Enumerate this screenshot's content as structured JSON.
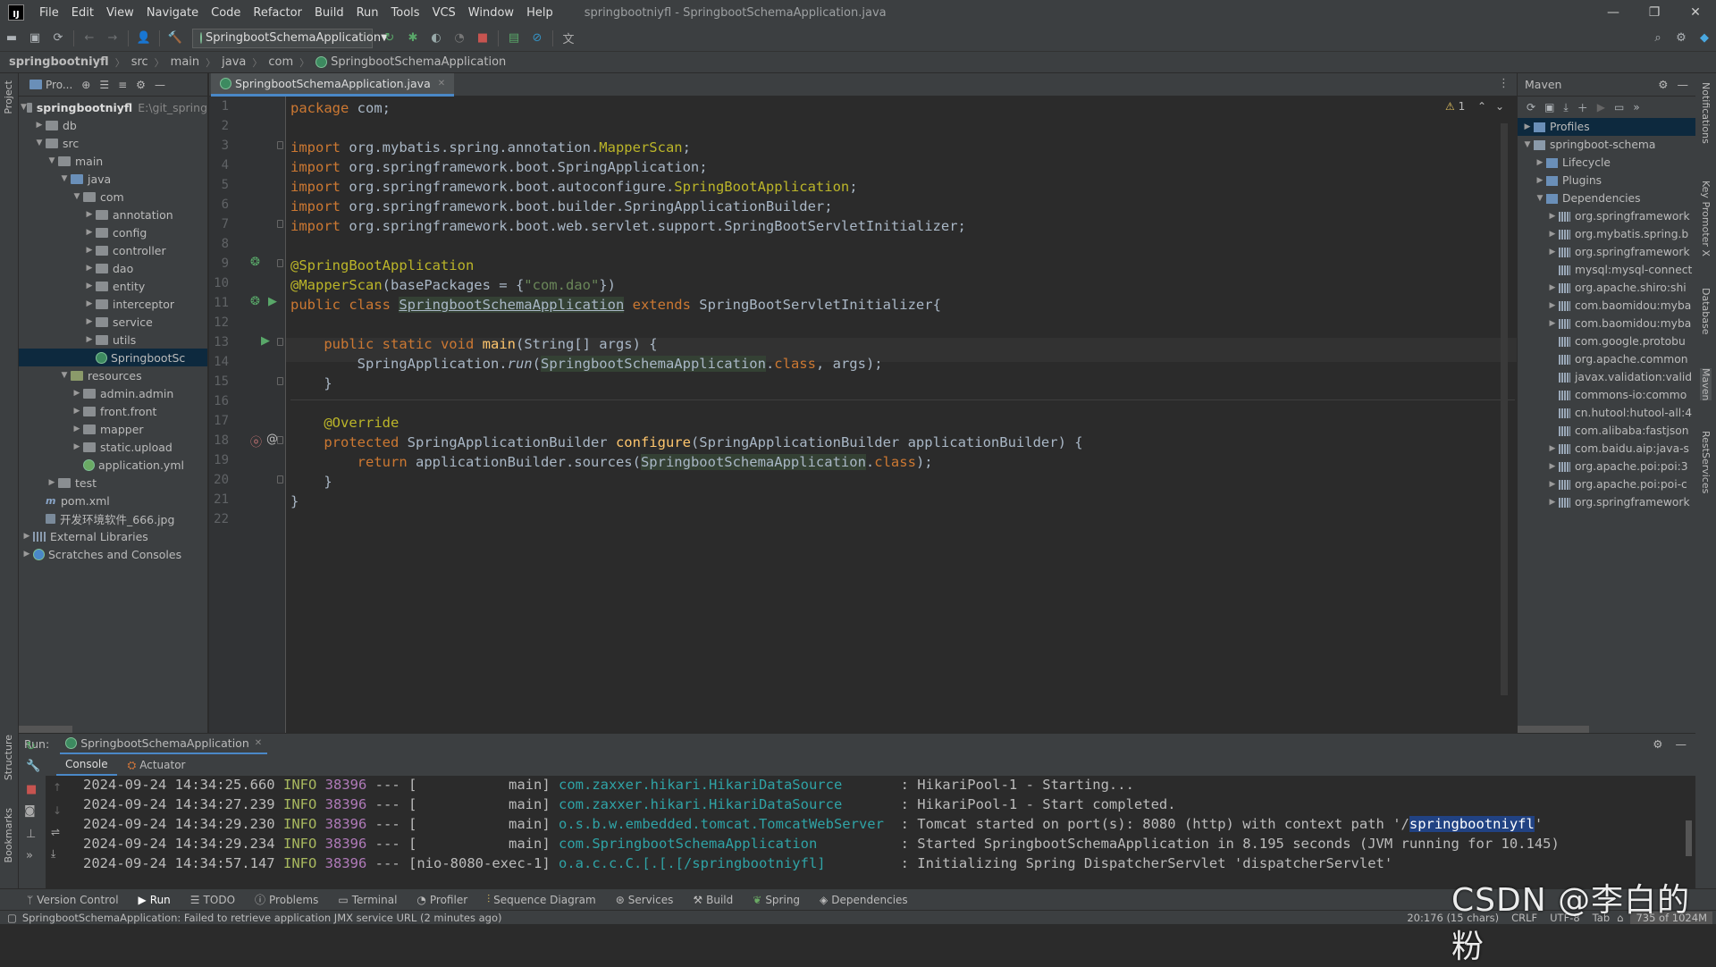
{
  "menubar": {
    "logo": "IJ",
    "items": [
      "File",
      "Edit",
      "View",
      "Navigate",
      "Code",
      "Refactor",
      "Build",
      "Run",
      "Tools",
      "VCS",
      "Window",
      "Help"
    ],
    "window_title": "springbootniyfl - SpringbootSchemaApplication.java"
  },
  "toolbar": {
    "run_config": "SpringbootSchemaApplication"
  },
  "navbar": {
    "crumbs": [
      "springbootniyfl",
      "src",
      "main",
      "java",
      "com",
      "SpringbootSchemaApplication"
    ]
  },
  "left_stripe": {
    "project": "Project",
    "structure": "Structure",
    "bookmarks": "Bookmarks"
  },
  "project_panel": {
    "title": "Pro...",
    "root_name": "springbootniyfl",
    "root_path": "E:\\git_spring",
    "tree": [
      {
        "label": "db",
        "depth": 1,
        "type": "folder"
      },
      {
        "label": "src",
        "depth": 1,
        "type": "folder",
        "open": true
      },
      {
        "label": "main",
        "depth": 2,
        "type": "folder",
        "open": true
      },
      {
        "label": "java",
        "depth": 3,
        "type": "folder-blue",
        "open": true
      },
      {
        "label": "com",
        "depth": 4,
        "type": "folder",
        "open": true
      },
      {
        "label": "annotation",
        "depth": 5,
        "type": "folder"
      },
      {
        "label": "config",
        "depth": 5,
        "type": "folder"
      },
      {
        "label": "controller",
        "depth": 5,
        "type": "folder"
      },
      {
        "label": "dao",
        "depth": 5,
        "type": "folder"
      },
      {
        "label": "entity",
        "depth": 5,
        "type": "folder"
      },
      {
        "label": "interceptor",
        "depth": 5,
        "type": "folder"
      },
      {
        "label": "service",
        "depth": 5,
        "type": "folder"
      },
      {
        "label": "utils",
        "depth": 5,
        "type": "folder"
      },
      {
        "label": "SpringbootSc",
        "depth": 5,
        "type": "class",
        "selected": true
      },
      {
        "label": "resources",
        "depth": 3,
        "type": "folder-res",
        "open": true
      },
      {
        "label": "admin.admin",
        "depth": 4,
        "type": "folder"
      },
      {
        "label": "front.front",
        "depth": 4,
        "type": "folder"
      },
      {
        "label": "mapper",
        "depth": 4,
        "type": "folder"
      },
      {
        "label": "static.upload",
        "depth": 4,
        "type": "folder"
      },
      {
        "label": "application.yml",
        "depth": 4,
        "type": "yml"
      },
      {
        "label": "test",
        "depth": 2,
        "type": "folder"
      },
      {
        "label": "pom.xml",
        "depth": 1,
        "type": "xml"
      },
      {
        "label": "开发环境软件_666.jpg",
        "depth": 1,
        "type": "file"
      },
      {
        "label": "External Libraries",
        "depth": 0,
        "type": "lib"
      },
      {
        "label": "Scratches and Consoles",
        "depth": 0,
        "type": "scratch"
      }
    ]
  },
  "editor": {
    "tab": "SpringbootSchemaApplication.java",
    "warnings": "1",
    "line_numbers": [
      "1",
      "2",
      "3",
      "4",
      "5",
      "6",
      "7",
      "8",
      "9",
      "10",
      "11",
      "12",
      "13",
      "14",
      "15",
      "16",
      "17",
      "18",
      "19",
      "20",
      "21",
      "22"
    ]
  },
  "maven": {
    "title": "Maven",
    "items": [
      {
        "label": "Profiles",
        "depth": 0,
        "icon": "folder",
        "selected": true
      },
      {
        "label": "springboot-schema",
        "depth": 0,
        "icon": "maven",
        "open": true
      },
      {
        "label": "Lifecycle",
        "depth": 1,
        "icon": "folder"
      },
      {
        "label": "Plugins",
        "depth": 1,
        "icon": "folder"
      },
      {
        "label": "Dependencies",
        "depth": 1,
        "icon": "folder",
        "open": true
      },
      {
        "label": "org.springframework",
        "depth": 2,
        "icon": "dep"
      },
      {
        "label": "org.mybatis.spring.b",
        "depth": 2,
        "icon": "dep"
      },
      {
        "label": "org.springframework",
        "depth": 2,
        "icon": "dep"
      },
      {
        "label": "mysql:mysql-connect",
        "depth": 2,
        "icon": "dep",
        "leaf": true
      },
      {
        "label": "org.apache.shiro:shi",
        "depth": 2,
        "icon": "dep"
      },
      {
        "label": "com.baomidou:myba",
        "depth": 2,
        "icon": "dep"
      },
      {
        "label": "com.baomidou:myba",
        "depth": 2,
        "icon": "dep"
      },
      {
        "label": "com.google.protobu",
        "depth": 2,
        "icon": "dep",
        "leaf": true
      },
      {
        "label": "org.apache.common",
        "depth": 2,
        "icon": "dep",
        "leaf": true
      },
      {
        "label": "javax.validation:valid",
        "depth": 2,
        "icon": "dep",
        "leaf": true
      },
      {
        "label": "commons-io:commo",
        "depth": 2,
        "icon": "dep",
        "leaf": true
      },
      {
        "label": "cn.hutool:hutool-all:4",
        "depth": 2,
        "icon": "dep",
        "leaf": true
      },
      {
        "label": "com.alibaba:fastjson",
        "depth": 2,
        "icon": "dep",
        "leaf": true
      },
      {
        "label": "com.baidu.aip:java-s",
        "depth": 2,
        "icon": "dep"
      },
      {
        "label": "org.apache.poi:poi:3",
        "depth": 2,
        "icon": "dep"
      },
      {
        "label": "org.apache.poi:poi-c",
        "depth": 2,
        "icon": "dep"
      },
      {
        "label": "org.springframework",
        "depth": 2,
        "icon": "dep"
      }
    ]
  },
  "right_stripe": [
    "Notifications",
    "Key Promoter X",
    "Database",
    "Maven",
    "RestServices"
  ],
  "run_panel": {
    "label": "Run:",
    "tab": "SpringbootSchemaApplication",
    "subtabs": [
      "Console",
      "Actuator"
    ],
    "log": [
      {
        "ts": "2024-09-24 14:34:25.660",
        "level": "INFO",
        "pid": "38396",
        "sep": "--- [",
        "thread": "           main]",
        "logger": "com.zaxxer.hikari.HikariDataSource      ",
        "msg": " : HikariPool-1 - Starting..."
      },
      {
        "ts": "2024-09-24 14:34:27.239",
        "level": "INFO",
        "pid": "38396",
        "sep": "--- [",
        "thread": "           main]",
        "logger": "com.zaxxer.hikari.HikariDataSource      ",
        "msg": " : HikariPool-1 - Start completed."
      },
      {
        "ts": "2024-09-24 14:34:29.230",
        "level": "INFO",
        "pid": "38396",
        "sep": "--- [",
        "thread": "           main]",
        "logger": "o.s.b.w.embedded.tomcat.TomcatWebServer ",
        "msg": " : Tomcat started on port(s): 8080 (http) with context path '/",
        "hl": "springbootniyfl",
        "tail": "'"
      },
      {
        "ts": "2024-09-24 14:34:29.234",
        "level": "INFO",
        "pid": "38396",
        "sep": "--- [",
        "thread": "           main]",
        "logger": "com.SpringbootSchemaApplication         ",
        "msg": " : Started SpringbootSchemaApplication in 8.195 seconds (JVM running for 10.145)"
      },
      {
        "ts": "2024-09-24 14:34:57.147",
        "level": "INFO",
        "pid": "38396",
        "sep": "--- [",
        "thread": "nio-8080-exec-1]",
        "logger": "o.a.c.c.C.[.[.[/springbootniyfl]        ",
        "msg": " : Initializing Spring DispatcherServlet 'dispatcherServlet'"
      }
    ]
  },
  "bottom_tools": [
    "Version Control",
    "Run",
    "TODO",
    "Problems",
    "Terminal",
    "Profiler",
    "Sequence Diagram",
    "Services",
    "Build",
    "Spring",
    "Dependencies"
  ],
  "statusbar": {
    "message": "SpringbootSchemaApplication: Failed to retrieve application JMX service URL (2 minutes ago)",
    "position": "20:176 (15 chars)",
    "line_sep": "CRLF",
    "encoding": "UTF-8",
    "indent": "Tab",
    "memory": "735 of 1024M"
  },
  "watermark": "CSDN @李白的粉"
}
